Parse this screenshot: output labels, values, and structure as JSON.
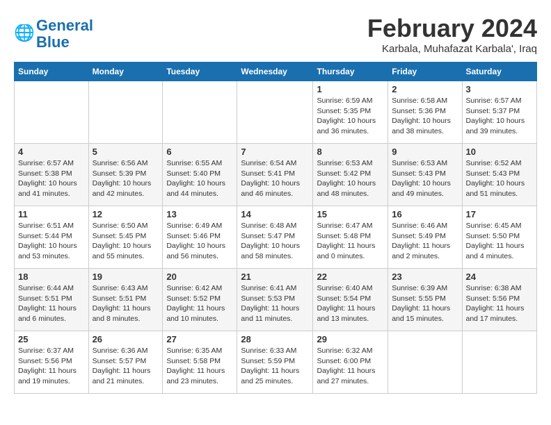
{
  "header": {
    "logo_line1": "General",
    "logo_line2": "Blue",
    "month_title": "February 2024",
    "location": "Karbala, Muhafazat Karbala', Iraq"
  },
  "weekdays": [
    "Sunday",
    "Monday",
    "Tuesday",
    "Wednesday",
    "Thursday",
    "Friday",
    "Saturday"
  ],
  "weeks": [
    [
      {
        "day": "",
        "sunrise": "",
        "sunset": "",
        "daylight": ""
      },
      {
        "day": "",
        "sunrise": "",
        "sunset": "",
        "daylight": ""
      },
      {
        "day": "",
        "sunrise": "",
        "sunset": "",
        "daylight": ""
      },
      {
        "day": "",
        "sunrise": "",
        "sunset": "",
        "daylight": ""
      },
      {
        "day": "1",
        "sunrise": "Sunrise: 6:59 AM",
        "sunset": "Sunset: 5:35 PM",
        "daylight": "Daylight: 10 hours and 36 minutes."
      },
      {
        "day": "2",
        "sunrise": "Sunrise: 6:58 AM",
        "sunset": "Sunset: 5:36 PM",
        "daylight": "Daylight: 10 hours and 38 minutes."
      },
      {
        "day": "3",
        "sunrise": "Sunrise: 6:57 AM",
        "sunset": "Sunset: 5:37 PM",
        "daylight": "Daylight: 10 hours and 39 minutes."
      }
    ],
    [
      {
        "day": "4",
        "sunrise": "Sunrise: 6:57 AM",
        "sunset": "Sunset: 5:38 PM",
        "daylight": "Daylight: 10 hours and 41 minutes."
      },
      {
        "day": "5",
        "sunrise": "Sunrise: 6:56 AM",
        "sunset": "Sunset: 5:39 PM",
        "daylight": "Daylight: 10 hours and 42 minutes."
      },
      {
        "day": "6",
        "sunrise": "Sunrise: 6:55 AM",
        "sunset": "Sunset: 5:40 PM",
        "daylight": "Daylight: 10 hours and 44 minutes."
      },
      {
        "day": "7",
        "sunrise": "Sunrise: 6:54 AM",
        "sunset": "Sunset: 5:41 PM",
        "daylight": "Daylight: 10 hours and 46 minutes."
      },
      {
        "day": "8",
        "sunrise": "Sunrise: 6:53 AM",
        "sunset": "Sunset: 5:42 PM",
        "daylight": "Daylight: 10 hours and 48 minutes."
      },
      {
        "day": "9",
        "sunrise": "Sunrise: 6:53 AM",
        "sunset": "Sunset: 5:43 PM",
        "daylight": "Daylight: 10 hours and 49 minutes."
      },
      {
        "day": "10",
        "sunrise": "Sunrise: 6:52 AM",
        "sunset": "Sunset: 5:43 PM",
        "daylight": "Daylight: 10 hours and 51 minutes."
      }
    ],
    [
      {
        "day": "11",
        "sunrise": "Sunrise: 6:51 AM",
        "sunset": "Sunset: 5:44 PM",
        "daylight": "Daylight: 10 hours and 53 minutes."
      },
      {
        "day": "12",
        "sunrise": "Sunrise: 6:50 AM",
        "sunset": "Sunset: 5:45 PM",
        "daylight": "Daylight: 10 hours and 55 minutes."
      },
      {
        "day": "13",
        "sunrise": "Sunrise: 6:49 AM",
        "sunset": "Sunset: 5:46 PM",
        "daylight": "Daylight: 10 hours and 56 minutes."
      },
      {
        "day": "14",
        "sunrise": "Sunrise: 6:48 AM",
        "sunset": "Sunset: 5:47 PM",
        "daylight": "Daylight: 10 hours and 58 minutes."
      },
      {
        "day": "15",
        "sunrise": "Sunrise: 6:47 AM",
        "sunset": "Sunset: 5:48 PM",
        "daylight": "Daylight: 11 hours and 0 minutes."
      },
      {
        "day": "16",
        "sunrise": "Sunrise: 6:46 AM",
        "sunset": "Sunset: 5:49 PM",
        "daylight": "Daylight: 11 hours and 2 minutes."
      },
      {
        "day": "17",
        "sunrise": "Sunrise: 6:45 AM",
        "sunset": "Sunset: 5:50 PM",
        "daylight": "Daylight: 11 hours and 4 minutes."
      }
    ],
    [
      {
        "day": "18",
        "sunrise": "Sunrise: 6:44 AM",
        "sunset": "Sunset: 5:51 PM",
        "daylight": "Daylight: 11 hours and 6 minutes."
      },
      {
        "day": "19",
        "sunrise": "Sunrise: 6:43 AM",
        "sunset": "Sunset: 5:51 PM",
        "daylight": "Daylight: 11 hours and 8 minutes."
      },
      {
        "day": "20",
        "sunrise": "Sunrise: 6:42 AM",
        "sunset": "Sunset: 5:52 PM",
        "daylight": "Daylight: 11 hours and 10 minutes."
      },
      {
        "day": "21",
        "sunrise": "Sunrise: 6:41 AM",
        "sunset": "Sunset: 5:53 PM",
        "daylight": "Daylight: 11 hours and 11 minutes."
      },
      {
        "day": "22",
        "sunrise": "Sunrise: 6:40 AM",
        "sunset": "Sunset: 5:54 PM",
        "daylight": "Daylight: 11 hours and 13 minutes."
      },
      {
        "day": "23",
        "sunrise": "Sunrise: 6:39 AM",
        "sunset": "Sunset: 5:55 PM",
        "daylight": "Daylight: 11 hours and 15 minutes."
      },
      {
        "day": "24",
        "sunrise": "Sunrise: 6:38 AM",
        "sunset": "Sunset: 5:56 PM",
        "daylight": "Daylight: 11 hours and 17 minutes."
      }
    ],
    [
      {
        "day": "25",
        "sunrise": "Sunrise: 6:37 AM",
        "sunset": "Sunset: 5:56 PM",
        "daylight": "Daylight: 11 hours and 19 minutes."
      },
      {
        "day": "26",
        "sunrise": "Sunrise: 6:36 AM",
        "sunset": "Sunset: 5:57 PM",
        "daylight": "Daylight: 11 hours and 21 minutes."
      },
      {
        "day": "27",
        "sunrise": "Sunrise: 6:35 AM",
        "sunset": "Sunset: 5:58 PM",
        "daylight": "Daylight: 11 hours and 23 minutes."
      },
      {
        "day": "28",
        "sunrise": "Sunrise: 6:33 AM",
        "sunset": "Sunset: 5:59 PM",
        "daylight": "Daylight: 11 hours and 25 minutes."
      },
      {
        "day": "29",
        "sunrise": "Sunrise: 6:32 AM",
        "sunset": "Sunset: 6:00 PM",
        "daylight": "Daylight: 11 hours and 27 minutes."
      },
      {
        "day": "",
        "sunrise": "",
        "sunset": "",
        "daylight": ""
      },
      {
        "day": "",
        "sunrise": "",
        "sunset": "",
        "daylight": ""
      }
    ]
  ]
}
